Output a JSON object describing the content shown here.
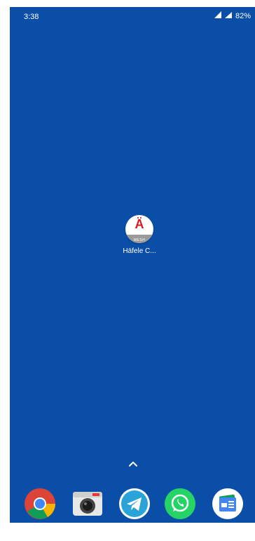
{
  "status_bar": {
    "time": "3:38",
    "battery": "82%",
    "icons": [
      "signal-icon",
      "wifi-icon",
      "battery-icon"
    ]
  },
  "home": {
    "app": {
      "label": "Häfele C...",
      "icon_glyph": "Ä",
      "icon_sublabel": "MESH",
      "icon_name": "hafele-connect-mesh-icon"
    }
  },
  "dock": {
    "items": [
      {
        "name": "chrome-icon"
      },
      {
        "name": "camera-icon"
      },
      {
        "name": "telegram-icon"
      },
      {
        "name": "whatsapp-icon"
      },
      {
        "name": "google-news-icon"
      }
    ]
  },
  "colors": {
    "wallpaper": "#0a4ea8",
    "hafele_red": "#d71920",
    "white": "#ffffff"
  }
}
